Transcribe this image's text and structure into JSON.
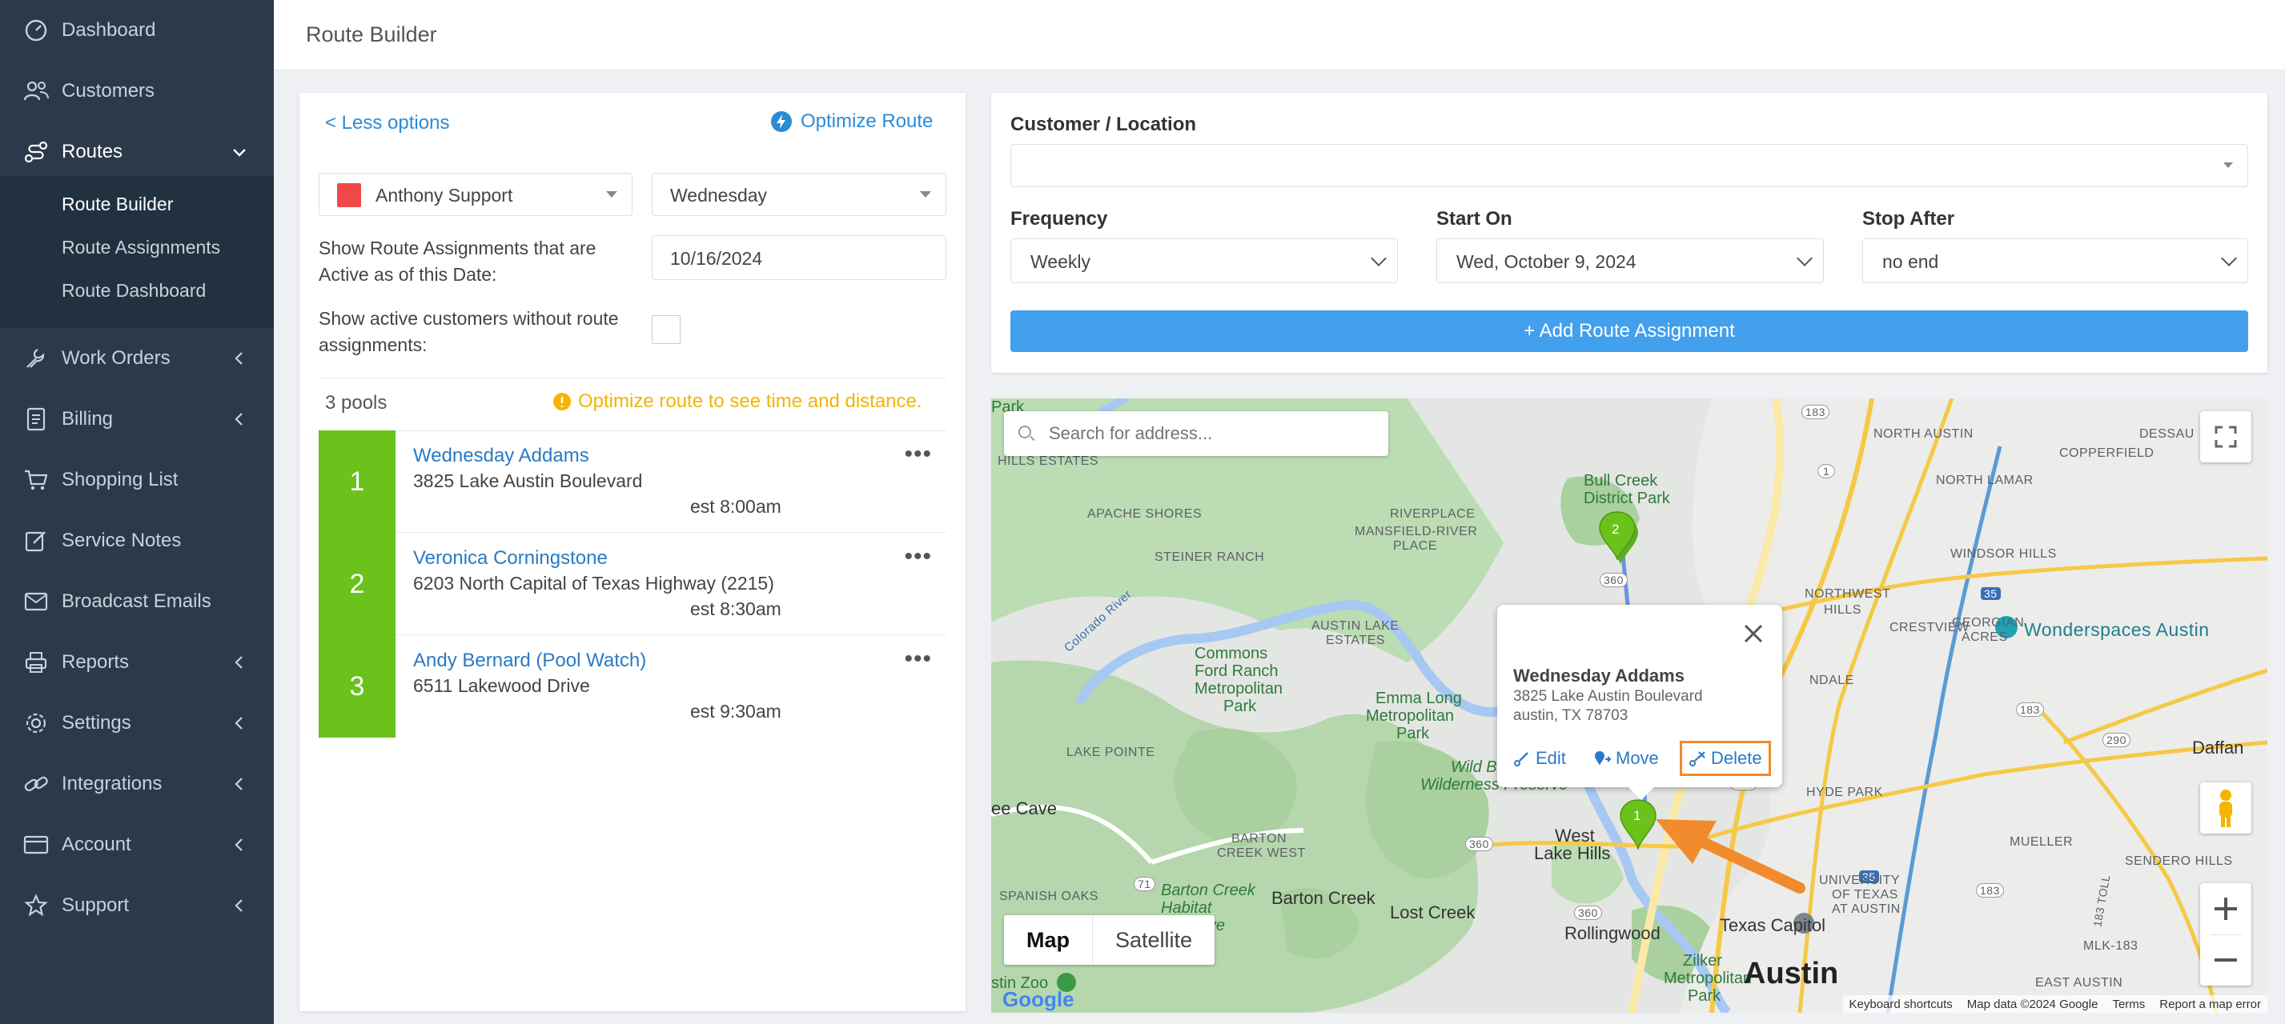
{
  "sidebar": {
    "items": [
      {
        "label": "Dashboard",
        "icon": "dashboard-icon"
      },
      {
        "label": "Customers",
        "icon": "users-icon"
      },
      {
        "label": "Routes",
        "icon": "route-icon"
      },
      {
        "label": "Work Orders",
        "icon": "wrench-icon"
      },
      {
        "label": "Billing",
        "icon": "document-icon"
      },
      {
        "label": "Shopping List",
        "icon": "cart-icon"
      },
      {
        "label": "Service Notes",
        "icon": "edit-icon"
      },
      {
        "label": "Broadcast Emails",
        "icon": "email-icon"
      },
      {
        "label": "Reports",
        "icon": "printer-icon"
      },
      {
        "label": "Settings",
        "icon": "gear-icon"
      },
      {
        "label": "Integrations",
        "icon": "link-icon"
      },
      {
        "label": "Account",
        "icon": "card-icon"
      },
      {
        "label": "Support",
        "icon": "star-icon"
      }
    ],
    "routes_sub": [
      "Route Builder",
      "Route Assignments",
      "Route Dashboard"
    ]
  },
  "header": {
    "title": "Route Builder"
  },
  "left": {
    "less_options": "< Less options",
    "optimize": "Optimize Route",
    "tech": {
      "name": "Anthony Support",
      "color": "#f04848"
    },
    "day": "Wednesday",
    "active_label": "Show Route Assignments that are Active as of this Date:",
    "active_date": "10/16/2024",
    "show_unassigned_label": "Show active customers without route assignments:",
    "pool_count": "3 pools",
    "optimize_hint": "Optimize route to see time and distance.",
    "stops": [
      {
        "num": "1",
        "name": "Wednesday Addams",
        "address": "3825 Lake Austin Boulevard",
        "est": "est 8:00am"
      },
      {
        "num": "2",
        "name": "Veronica Corningstone",
        "address": "6203 North Capital of Texas Highway (2215)",
        "est": "est 8:30am"
      },
      {
        "num": "3",
        "name": "Andy Bernard (Pool Watch)",
        "address": "6511 Lakewood Drive",
        "est": "est 9:30am"
      }
    ]
  },
  "form": {
    "customer_label": "Customer / Location",
    "frequency_label": "Frequency",
    "frequency_value": "Weekly",
    "start_label": "Start On",
    "start_value": "Wed, October 9, 2024",
    "stop_label": "Stop After",
    "stop_value": "no end",
    "add_button": "+ Add Route Assignment"
  },
  "map": {
    "search_placeholder": "Search for address...",
    "type_map": "Map",
    "type_satellite": "Satellite",
    "labels": {
      "dessau": "DESSAU",
      "north_austin": "NORTH AUSTIN",
      "copperfield": "COPPERFIELD",
      "hills_estates": "HILLS ESTATES",
      "north_lamar": "NORTH LAMAR",
      "apache_shores": "APACHE SHORES",
      "riverplace": "RIVERPLACE",
      "mansfield": "MANSFIELD-RIVER",
      "place": "PLACE",
      "steiner": "STEINER RANCH",
      "windsor": "WINDSOR HILLS",
      "northwest": "NORTHWEST",
      "hills": "HILLS",
      "colorado": "Colorado River",
      "austin_lake": "AUSTIN LAKE",
      "estates": "ESTATES",
      "crestview": "CRESTVIEW",
      "georgian": "GEORGIAN",
      "acres": "ACRES",
      "wonderspaces": "Wonderspaces Austin",
      "lake_pointe": "LAKE POINTE",
      "ndale": "NDALE",
      "hyde_park": "HYDE PARK",
      "daffan": "Daffan",
      "ee_cave": "ee Cave",
      "barton_creek_west": "BARTON",
      "creek_west": "CREEK WEST",
      "west_lake": "West",
      "lake_hills": "Lake Hills",
      "mueller": "MUELLER",
      "spanish_oaks": "SPANISH OAKS",
      "barton_creek": "Barton Creek",
      "lost_creek": "Lost Creek",
      "rollingwood": "Rollingwood",
      "university": "UNIVERSITY",
      "of_texas": "OF TEXAS",
      "at_austin": "AT AUSTIN",
      "sendero": "SENDERO HILLS",
      "mlk": "MLK-183",
      "austin": "Austin",
      "east_austin": "EAST AUSTIN",
      "texas_capitol": "Texas Capitol",
      "park": "Park",
      "bull_creek": "Bull Creek",
      "district_park": "District Park",
      "commons": "Commons",
      "ford_ranch": "Ford Ranch",
      "metropolitan": "Metropolitan",
      "park2": "Park",
      "emma_long": "Emma Long",
      "metropolitan2": "Metropolitan",
      "park3": "Park",
      "wild_b": "Wild B",
      "wilderness": "Wilderness Preserve",
      "barton_creek_habitat": "Barton Creek",
      "habitat": "Habitat",
      "preserve": "Preserve",
      "zilker": "Zilker",
      "metropolitan3": "Metropolitan",
      "park4": "Park",
      "zoo": "stin Zoo",
      "toll": "183 Toll"
    },
    "shields": [
      "183",
      "1",
      "360",
      "35",
      "183",
      "290",
      "360",
      "71",
      "35",
      "360",
      "360",
      "183"
    ],
    "popup": {
      "name": "Wednesday Addams",
      "line1": "3825 Lake Austin Boulevard",
      "line2": "austin, TX  78703",
      "edit": "Edit",
      "move": "Move",
      "delete": "Delete"
    },
    "markers": [
      "1",
      "2"
    ],
    "attribution": {
      "shortcuts": "Keyboard shortcuts",
      "data": "Map data ©2024 Google",
      "terms": "Terms",
      "report": "Report a map error"
    },
    "google": "Google"
  }
}
